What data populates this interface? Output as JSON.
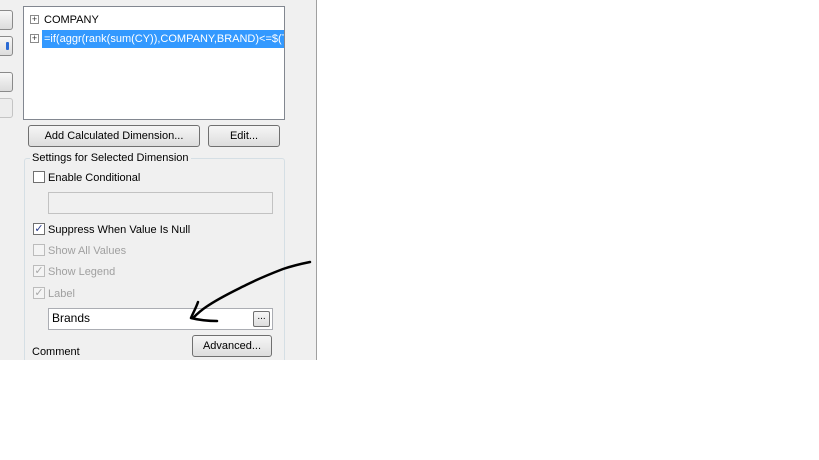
{
  "dimensions_list": {
    "items": [
      {
        "label": "COMPANY",
        "expander": "+"
      },
      {
        "label": "=if(aggr(rank(sum(CY)),COMPANY,BRAND)<=$(T",
        "expander": "+"
      }
    ]
  },
  "buttons": {
    "add_calculated": "Add Calculated Dimension...",
    "edit": "Edit...",
    "ellipsis": "...",
    "advanced": "Advanced..."
  },
  "settings": {
    "group_title": "Settings for Selected Dimension",
    "enable_conditional": {
      "label": "Enable Conditional",
      "checked": false
    },
    "conditional_value": "",
    "suppress_null": {
      "label": "Suppress When Value Is Null",
      "checked": true
    },
    "show_all_values": {
      "label": "Show All Values",
      "checked": false
    },
    "show_legend": {
      "label": "Show Legend",
      "checked": true
    },
    "label": {
      "label": "Label",
      "checked": true
    },
    "label_value": "Brands",
    "comment_label": "Comment"
  },
  "colors": {
    "selection": "#3399ff",
    "dialog_bg": "#f0f0f0",
    "annotation_stroke": "#000000"
  }
}
